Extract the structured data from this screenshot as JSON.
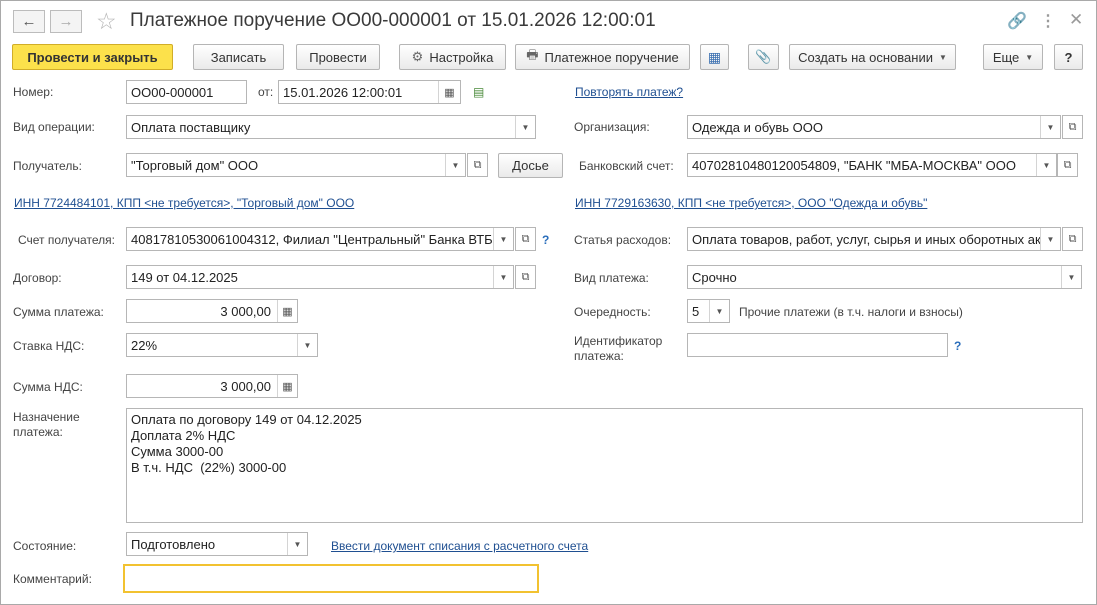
{
  "window": {
    "title": "Платежное поручение ОО00-000001 от 15.01.2026 12:00:01",
    "back_icon": "arrow-left-icon",
    "forward_icon": "arrow-right-icon"
  },
  "toolbar": {
    "post_close": "Провести и закрыть",
    "save": "Записать",
    "post": "Провести",
    "settings": "Настройка",
    "print_order": "Платежное поручение",
    "create_based": "Создать на основании",
    "more": "Еще",
    "help": "?"
  },
  "form": {
    "number_label": "Номер:",
    "number_value": "ОО00-000001",
    "date_label": "от:",
    "date_value": "15.01.2026 12:00:01",
    "repeat_link": "Повторять платеж?",
    "op_type_label": "Вид операции:",
    "op_type_value": "Оплата поставщику",
    "org_label": "Организация:",
    "org_value": "Одежда и обувь ООО",
    "recipient_label": "Получатель:",
    "recipient_value": "\"Торговый дом\" ООО",
    "dossier": "Досье",
    "bank_account_label": "Банковский счет:",
    "bank_account_value": "40702810480120054809, \"БАНК \"МБА-МОСКВА\" ООО",
    "inn_recipient_link": "ИНН 7724484101, КПП <не требуется>, \"Торговый дом\" ООО",
    "inn_org_link": "ИНН 7729163630, КПП <не требуется>, ООО \"Одежда и обувь\"",
    "recipient_account_label": "Счет получателя:",
    "recipient_account_value": "40817810530061004312, Филиал \"Центральный\" Банка ВТБ",
    "expense_item_label": "Статья расходов:",
    "expense_item_value": "Оплата товаров, работ, услуг, сырья и иных оборотных ак",
    "contract_label": "Договор:",
    "contract_value": "149 от 04.12.2025",
    "payment_type_label": "Вид платежа:",
    "payment_type_value": "Срочно",
    "amount_label": "Сумма платежа:",
    "amount_value": "3 000,00",
    "priority_label": "Очередность:",
    "priority_value": "5",
    "priority_desc": "Прочие платежи (в т.ч. налоги и взносы)",
    "vat_rate_label": "Ставка НДС:",
    "vat_rate_value": "22%",
    "payment_id_label": "Идентификатор платежа:",
    "payment_id_value": "",
    "vat_amount_label": "Сумма НДС:",
    "vat_amount_value": "3 000,00",
    "purpose_label": "Назначение платежа:",
    "purpose_lines": [
      "Оплата по договору 149 от 04.12.2025",
      "Доплата 2% НДС",
      "Сумма 3000-00",
      "В т.ч. НДС  (22%) 3000-00"
    ],
    "status_label": "Состояние:",
    "status_value": "Подготовлено",
    "enter_writeoff_link": "Ввести документ списания с расчетного счета",
    "comment_label": "Комментарий:",
    "comment_value": ""
  },
  "colors": {
    "primary_button": "#fce14b",
    "link": "#1f4f91",
    "focus_border": "#f2c230"
  }
}
